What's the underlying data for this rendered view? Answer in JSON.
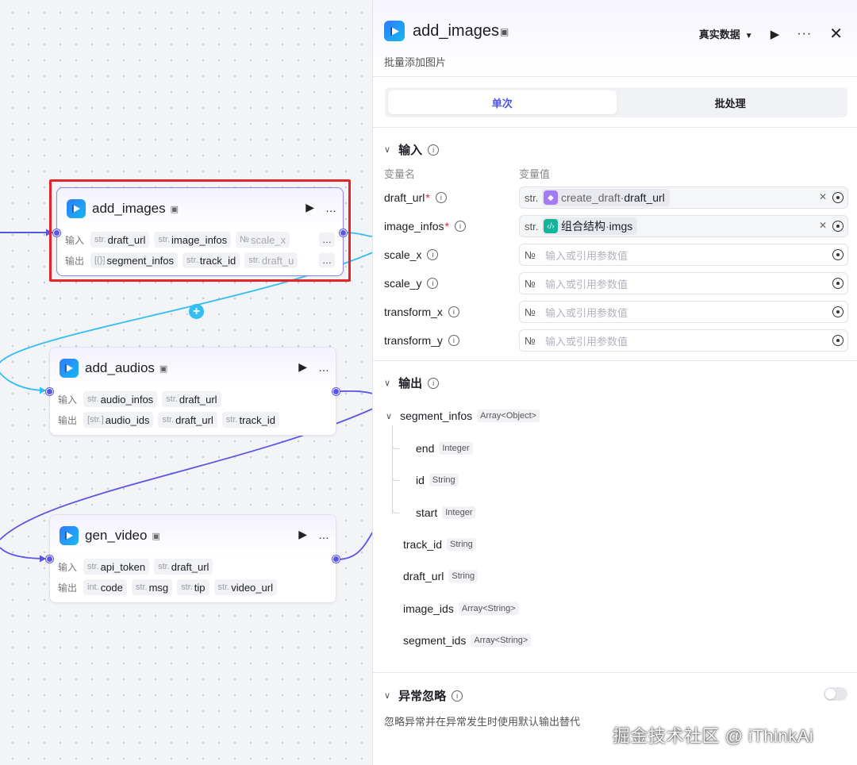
{
  "canvas": {
    "nodes": [
      {
        "title": "add_images",
        "input_label": "输入",
        "output_label": "输出",
        "inputs": [
          {
            "type": "str.",
            "name": "draft_url"
          },
          {
            "type": "str.",
            "name": "image_infos"
          },
          {
            "type": "№",
            "name": "scale_x"
          }
        ],
        "outputs": [
          {
            "type": "[{}]",
            "name": "segment_infos"
          },
          {
            "type": "str.",
            "name": "track_id"
          },
          {
            "type": "str.",
            "name": "draft_u"
          }
        ]
      },
      {
        "title": "add_audios",
        "input_label": "输入",
        "output_label": "输出",
        "inputs": [
          {
            "type": "str.",
            "name": "audio_infos"
          },
          {
            "type": "str.",
            "name": "draft_url"
          }
        ],
        "outputs": [
          {
            "type": "[str.]",
            "name": "audio_ids"
          },
          {
            "type": "str.",
            "name": "draft_url"
          },
          {
            "type": "str.",
            "name": "track_id"
          }
        ]
      },
      {
        "title": "gen_video",
        "input_label": "输入",
        "output_label": "输出",
        "inputs": [
          {
            "type": "str.",
            "name": "api_token"
          },
          {
            "type": "str.",
            "name": "draft_url"
          }
        ],
        "outputs": [
          {
            "type": "int.",
            "name": "code"
          },
          {
            "type": "str.",
            "name": "msg"
          },
          {
            "type": "str.",
            "name": "tip"
          },
          {
            "type": "str.",
            "name": "video_url"
          }
        ]
      }
    ],
    "more_icon": "…",
    "run_icon": "▶"
  },
  "panel": {
    "title": "add_images",
    "description": "批量添加图片",
    "data_mode": "真实数据",
    "tabs": [
      "单次",
      "批处理"
    ],
    "active_tab": 0,
    "input_section": {
      "title": "输入",
      "col_name": "变量名",
      "col_value": "变量值",
      "placeholder": "输入或引用参数值",
      "rows": [
        {
          "name": "draft_url",
          "required": true,
          "type": "str.",
          "ref_node": "create_draft",
          "ref_sep": " · ",
          "ref_field": "draft_url",
          "ref_color": "#a57af5"
        },
        {
          "name": "image_infos",
          "required": true,
          "type": "str.",
          "ref_node": "组合结构",
          "ref_sep": " · ",
          "ref_field": "imgs",
          "ref_color": "#14b49a"
        },
        {
          "name": "scale_x",
          "required": false,
          "type": "№"
        },
        {
          "name": "scale_y",
          "required": false,
          "type": "№"
        },
        {
          "name": "transform_x",
          "required": false,
          "type": "№"
        },
        {
          "name": "transform_y",
          "required": false,
          "type": "№"
        }
      ]
    },
    "output_section": {
      "title": "输出",
      "items": [
        {
          "name": "segment_infos",
          "type": "Array<Object>"
        },
        {
          "name": "end",
          "type": "Integer"
        },
        {
          "name": "id",
          "type": "String"
        },
        {
          "name": "start",
          "type": "Integer"
        },
        {
          "name": "track_id",
          "type": "String"
        },
        {
          "name": "draft_url",
          "type": "String"
        },
        {
          "name": "image_ids",
          "type": "Array<String>"
        },
        {
          "name": "segment_ids",
          "type": "Array<String>"
        }
      ]
    },
    "error_section": {
      "title": "异常忽略",
      "description": "忽略异常并在异常发生时使用默认输出替代",
      "enabled": false
    }
  },
  "watermark": "掘金技术社区 @ iThinkAi"
}
